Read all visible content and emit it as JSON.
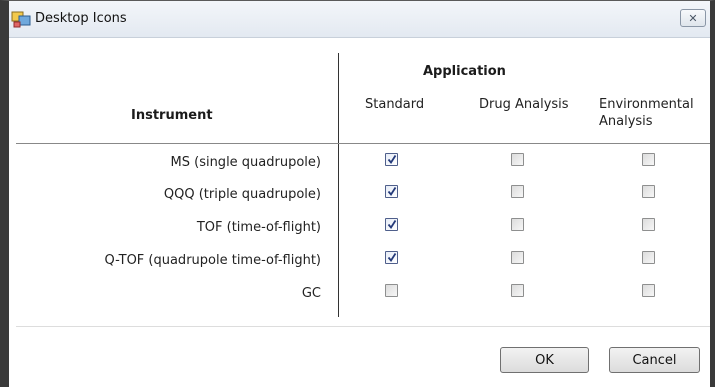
{
  "window": {
    "title": "Desktop Icons",
    "close_symbol": "✕"
  },
  "table": {
    "group_header": "Application",
    "instrument_header": "Instrument",
    "columns": [
      "Standard",
      "Drug Analysis",
      "Environmental Analysis"
    ],
    "rows": [
      {
        "label": "MS (single quadrupole)",
        "standard": true,
        "drug_analysis": false,
        "environmental_analysis": false
      },
      {
        "label": "QQQ (triple quadrupole)",
        "standard": true,
        "drug_analysis": false,
        "environmental_analysis": false
      },
      {
        "label": "TOF (time-of-flight)",
        "standard": true,
        "drug_analysis": false,
        "environmental_analysis": false
      },
      {
        "label": "Q-TOF (quadrupole time-of-flight)",
        "standard": true,
        "drug_analysis": false,
        "environmental_analysis": false
      },
      {
        "label": "GC",
        "standard": false,
        "drug_analysis": false,
        "environmental_analysis": false
      }
    ]
  },
  "buttons": {
    "ok_label": "OK",
    "cancel_label": "Cancel"
  },
  "icons": {
    "app": "desktop-icons-app-icon",
    "close": "close-icon",
    "check": "checkmark-icon"
  }
}
